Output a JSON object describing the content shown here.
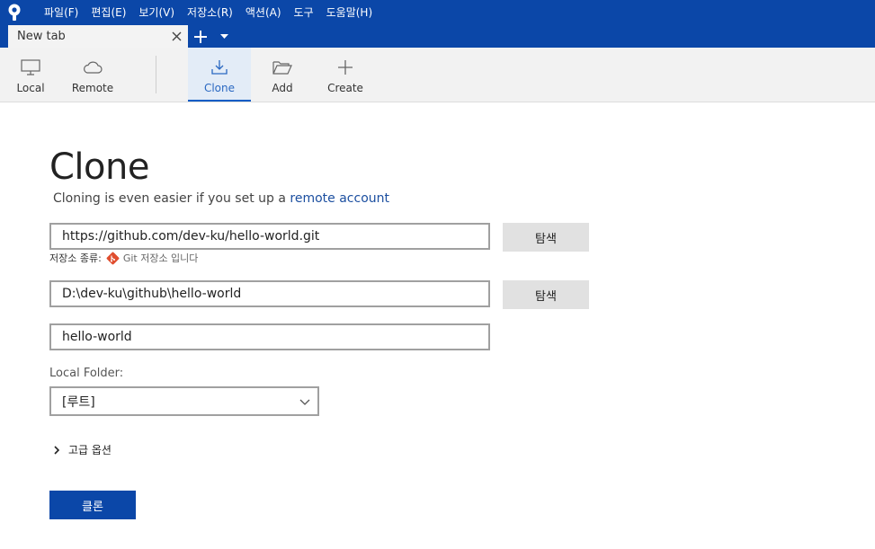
{
  "menu": {
    "items": [
      "파일(F)",
      "편집(E)",
      "보기(V)",
      "저장소(R)",
      "액션(A)",
      "도구",
      "도움말(H)"
    ]
  },
  "tabs": {
    "active_title": "New tab"
  },
  "toolbar": {
    "local": "Local",
    "remote": "Remote",
    "clone": "Clone",
    "add": "Add",
    "create": "Create"
  },
  "clone_form": {
    "title": "Clone",
    "subtitle_text": "Cloning is even easier if you set up a ",
    "subtitle_link": "remote account",
    "source_url": "https://github.com/dev-ku/hello-world.git",
    "browse_label": "탐색",
    "repo_type_label": "저장소 종류:",
    "repo_type_value": "Git 저장소 입니다",
    "dest_path": "D:\\dev-ku\\github\\hello-world",
    "name": "hello-world",
    "local_folder_label": "Local Folder:",
    "local_folder_value": "[루트]",
    "advanced_label": "고급 옵션",
    "clone_button": "클론"
  },
  "colors": {
    "brand": "#0b47a8",
    "accent": "#2a68c2",
    "git": "#e04e2f"
  }
}
